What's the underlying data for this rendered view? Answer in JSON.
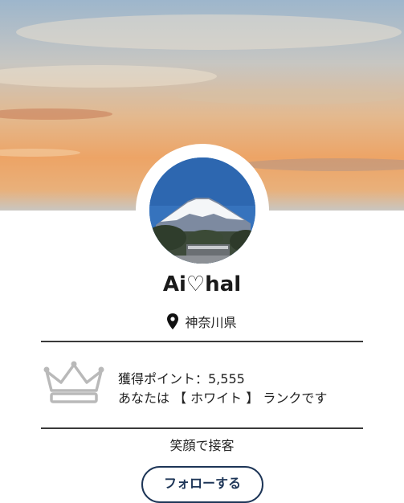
{
  "profile": {
    "username": "Ai♡hal",
    "location": "神奈川県",
    "points_line": "獲得ポイント：5,555",
    "rank_line": "あなたは 【 ホワイト 】 ランクです",
    "bio": "笑顔で接客",
    "button_label": "フォローする"
  },
  "icons": {
    "location": "map-pin-icon",
    "rank": "crown-icon"
  },
  "colors": {
    "rule": "#3a3a3a",
    "crown": "#b9b9b9",
    "button_border": "#1d3557"
  }
}
